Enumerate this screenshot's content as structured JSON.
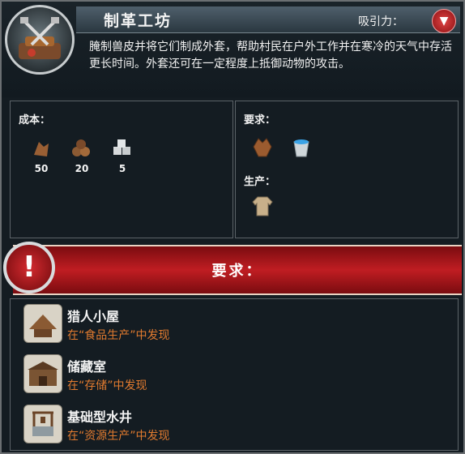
{
  "header": {
    "title": "制革工坊",
    "attraction_label": "吸引力：",
    "attraction_icon": "chevron-down-icon",
    "description": "腌制兽皮并将它们制成外套，帮助村民在户外工作并在寒冷的天气中存活更长时间。外套还可在一定程度上抵御动物的攻击。"
  },
  "cost": {
    "label": "成本：",
    "items": [
      {
        "icon": "hide-icon",
        "amount": "50"
      },
      {
        "icon": "logs-icon",
        "amount": "20"
      },
      {
        "icon": "stone-icon",
        "amount": "5"
      }
    ]
  },
  "requirements": {
    "label": "要求：",
    "icons": [
      "pelt-icon",
      "water-bucket-icon"
    ],
    "produce_label": "生产：",
    "produce_icon": "coat-icon"
  },
  "banner": {
    "label": "要求："
  },
  "required_buildings": [
    {
      "name": "猎人小屋",
      "hint": "在“食品生产”中发现",
      "icon": "hunter-cabin-icon"
    },
    {
      "name": "储藏室",
      "hint": "在“存储”中发现",
      "icon": "storehouse-icon"
    },
    {
      "name": "基础型水井",
      "hint": "在“资源生产”中发现",
      "icon": "well-icon"
    }
  ],
  "colors": {
    "accent_red": "#c01d22",
    "hint_orange": "#e07a2f"
  }
}
